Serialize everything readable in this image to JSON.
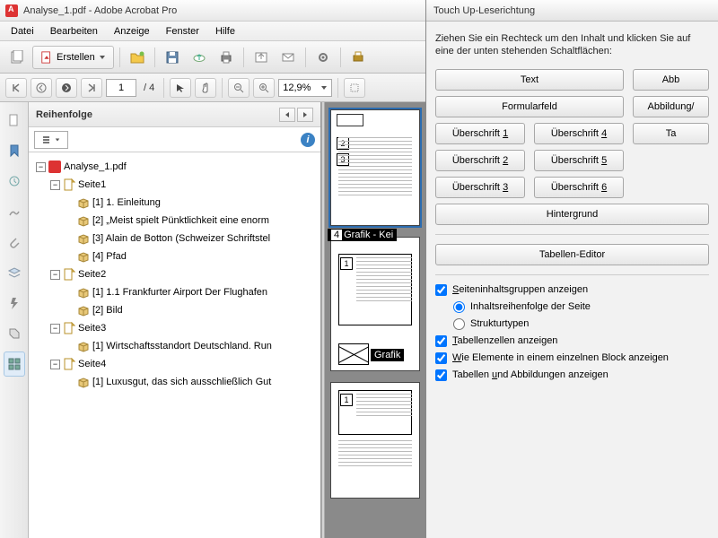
{
  "window": {
    "title": "Analyse_1.pdf - Adobe Acrobat Pro"
  },
  "menu": [
    "Datei",
    "Bearbeiten",
    "Anzeige",
    "Fenster",
    "Hilfe"
  ],
  "toolbar": {
    "create_label": "Erstellen"
  },
  "nav": {
    "page_current": "1",
    "page_total": "/  4",
    "zoom": "12,9%"
  },
  "order_panel": {
    "title": "Reihenfolge",
    "root": "Analyse_1.pdf",
    "pages": [
      {
        "label": "Seite1",
        "items": [
          "[1]  1. Einleitung",
          "[2]  „Meist spielt Pünktlichkeit eine enorm",
          "[3]  Alain de Botton (Schweizer Schriftstel",
          "[4]  Pfad"
        ]
      },
      {
        "label": "Seite2",
        "items": [
          "[1]  1.1 Frankfurter Airport Der Flughafen",
          "[2]  Bild"
        ]
      },
      {
        "label": "Seite3",
        "items": [
          "[1]  Wirtschaftsstandort Deutschland. Run"
        ]
      },
      {
        "label": "Seite4",
        "items": [
          "[1]  Luxusgut, das sich ausschließlich Gut"
        ]
      }
    ]
  },
  "thumbs": {
    "tag1": "Grafik - Kei",
    "tag2": "Grafik"
  },
  "dialog": {
    "title": "Touch Up-Leserichtung",
    "instruction": "Ziehen Sie ein Rechteck um den Inhalt und klicken Sie auf eine der unten stehenden Schaltflächen:",
    "buttons": {
      "text": "Text",
      "abb": "Abb",
      "form": "Formularfeld",
      "abbildung": "Abbildung/",
      "h1": "Überschrift 1",
      "h4": "Überschrift 4",
      "ta": "Ta",
      "h2": "Überschrift 2",
      "h5": "Überschrift 5",
      "h3": "Überschrift 3",
      "h6": "Überschrift 6",
      "bg": "Hintergrund",
      "tbl_editor": "Tabellen-Editor"
    },
    "checks": {
      "show_groups": "Seiteninhaltsgruppen anzeigen",
      "order": "Inhaltsreihenfolge der Seite",
      "struct": "Strukturtypen",
      "cells": "Tabellenzellen anzeigen",
      "block": "Wie Elemente in einem einzelnen Block anzeigen",
      "tbl_fig": "Tabellen und Abbildungen anzeigen"
    }
  }
}
